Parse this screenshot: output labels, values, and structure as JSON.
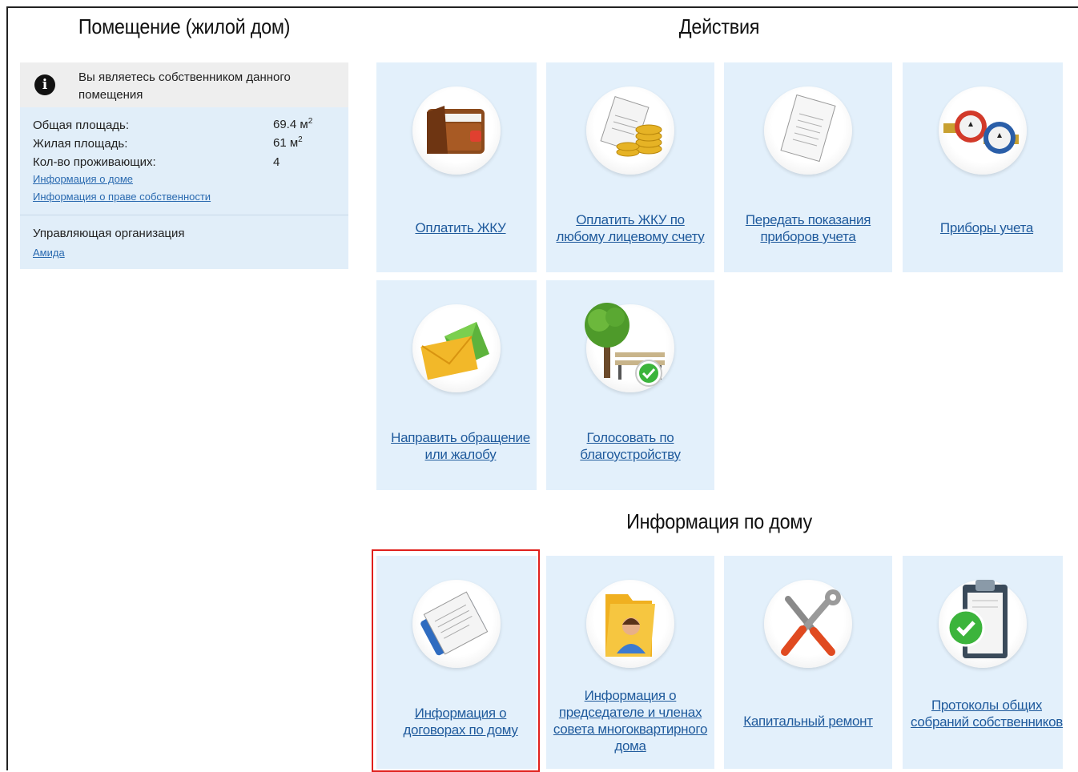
{
  "premises": {
    "title": "Помещение (жилой дом)",
    "notice": "Вы являетесь собственником данного помещения",
    "rows": [
      {
        "label": "Общая площадь:",
        "value": "69.4 м",
        "sup": "2"
      },
      {
        "label": "Жилая площадь:",
        "value": "61 м",
        "sup": "2"
      },
      {
        "label": "Кол-во проживающих:",
        "value": "4",
        "sup": ""
      }
    ],
    "links": [
      "Информация о доме",
      "Информация о праве собственности"
    ],
    "org_label": "Управляющая организация",
    "org_link": "Амида"
  },
  "actions": {
    "title": "Действия",
    "cards": [
      {
        "label": "Оплатить ЖКУ",
        "icon": "wallet-icon"
      },
      {
        "label": "Оплатить ЖКУ по любому лицевому счету",
        "icon": "bill-coins-icon"
      },
      {
        "label": "Передать показания приборов учета",
        "icon": "readings-paper-icon"
      },
      {
        "label": "Приборы учета",
        "icon": "water-meter-icon"
      },
      {
        "label": "Направить обращение или жалобу",
        "icon": "envelope-icon"
      },
      {
        "label": "Голосовать по благоустройству",
        "icon": "tree-bench-icon"
      }
    ]
  },
  "house_info": {
    "title": "Информация по дому",
    "cards": [
      {
        "label": "Информация о договорах по дому",
        "icon": "contract-icon",
        "selected": true
      },
      {
        "label": "Информация о председателе и членах совета многоквартирного дома",
        "icon": "folder-person-icon"
      },
      {
        "label": "Капитальный ремонт",
        "icon": "tools-icon"
      },
      {
        "label": "Протоколы общих собраний собственников",
        "icon": "clipboard-check-icon"
      }
    ]
  }
}
